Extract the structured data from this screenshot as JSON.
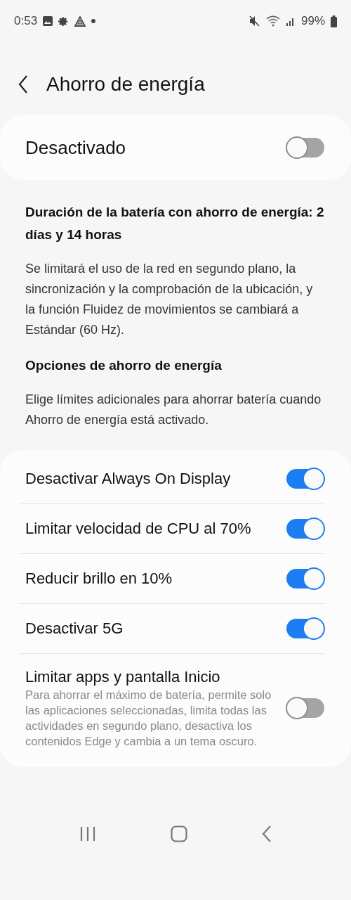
{
  "status_bar": {
    "time": "0:53",
    "battery": "99%"
  },
  "header": {
    "title": "Ahorro de energía"
  },
  "master": {
    "label": "Desactivado",
    "on": false
  },
  "duration": {
    "text": "Duración de la batería con ahorro de energía: 2 días y 14 horas"
  },
  "description": "Se limitará el uso de la red en segundo plano, la sincronización y la comprobación de la ubicación, y la función Fluidez de movimientos se cambiará a Estándar (60 Hz).",
  "options_heading": "Opciones de ahorro de energía",
  "options_description": "Elige límites adicionales para ahorrar batería cuando Ahorro de energía está activado.",
  "options": [
    {
      "label": "Desactivar Always On Display",
      "on": true
    },
    {
      "label": "Limitar velocidad de CPU al 70%",
      "on": true
    },
    {
      "label": "Reducir brillo en 10%",
      "on": true
    },
    {
      "label": "Desactivar 5G",
      "on": true
    },
    {
      "label": "Limitar apps y pantalla Inicio",
      "description": "Para ahorrar el máximo de batería, permite solo las aplicaciones seleccionadas, limita todas las actividades en segundo plano, desactiva los contenidos Edge y cambia a un tema oscuro.",
      "on": false
    }
  ]
}
